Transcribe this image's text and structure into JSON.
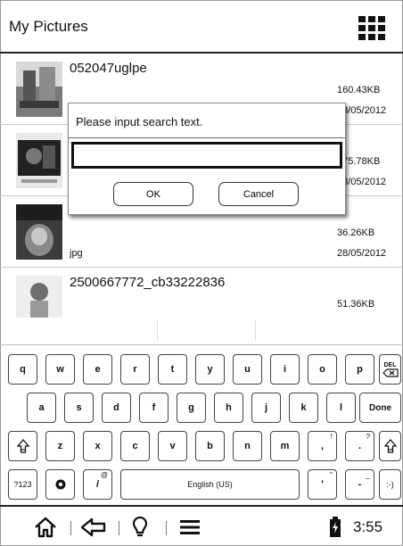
{
  "header": {
    "title": "My Pictures",
    "menu_icon": "grid-icon"
  },
  "files": [
    {
      "name": "052047uglpe",
      "size": "160.43KB",
      "date": "28/05/2012",
      "ext": ""
    },
    {
      "name": "",
      "size": "275.78KB",
      "date": "28/05/2012",
      "ext": ""
    },
    {
      "name": "",
      "size": "36.26KB",
      "date": "28/05/2012",
      "ext": "jpg"
    },
    {
      "name": "2500667772_cb33222836",
      "size": "51.36KB",
      "date": "",
      "ext": ""
    }
  ],
  "dialog": {
    "prompt": "Please input search text.",
    "input_value": "",
    "ok_label": "OK",
    "cancel_label": "Cancel"
  },
  "keyboard": {
    "row1": [
      "q",
      "w",
      "e",
      "r",
      "t",
      "y",
      "u",
      "i",
      "o",
      "p"
    ],
    "del_label": "DEL",
    "row2": [
      "a",
      "s",
      "d",
      "f",
      "g",
      "h",
      "j",
      "k",
      "l"
    ],
    "done_label": "Done",
    "row3": [
      "z",
      "x",
      "c",
      "v",
      "b",
      "n",
      "m"
    ],
    "comma": ",",
    "comma_alt": "!",
    "period": ".",
    "period_alt": "?",
    "symbols_label": "?123",
    "slash": "/",
    "slash_alt": "@",
    "space_label": "English (US)",
    "apostrophe": "'",
    "apostrophe_alt": "\"",
    "dash": "-",
    "dash_alt": "_",
    "smiley": ":-)"
  },
  "bottom_bar": {
    "time": "3:55"
  },
  "colors": {
    "frame": "#222222",
    "background": "#ffffff"
  }
}
